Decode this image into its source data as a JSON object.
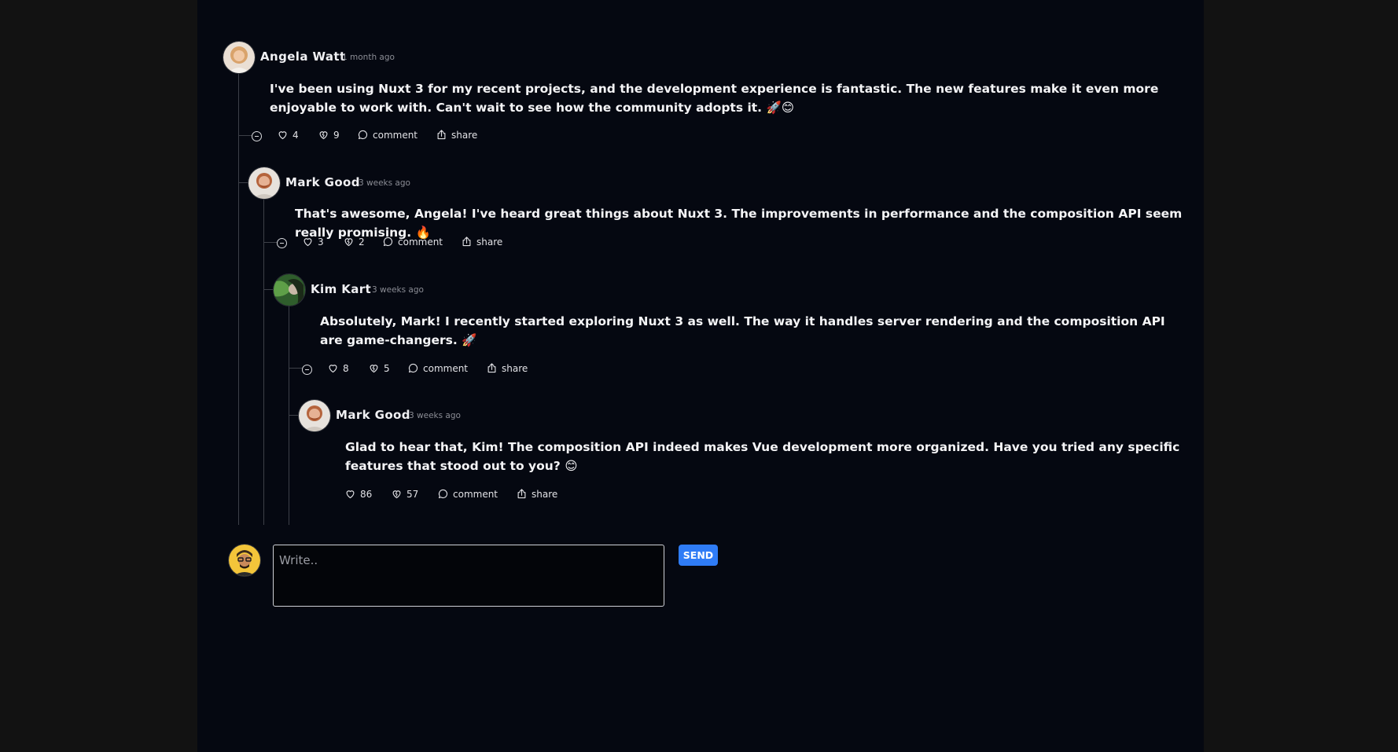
{
  "comments": [
    {
      "author": "Angela Watt",
      "time": "1 month ago",
      "text": "I've been using Nuxt 3 for my recent projects, and the development experience is fantastic. The new features make it even more enjoyable to work with. Can't wait to see how the community adopts it. 🚀😊",
      "likes": "4",
      "dislikes": "9",
      "comment_label": "comment",
      "share_label": "share"
    },
    {
      "author": "Mark Good",
      "time": "3 weeks ago",
      "text": "That's awesome, Angela! I've heard great things about Nuxt 3. The improvements in performance and the composition API seem really promising. 🔥",
      "likes": "3",
      "dislikes": "2",
      "comment_label": "comment",
      "share_label": "share"
    },
    {
      "author": "Kim Kart",
      "time": "3 weeks ago",
      "text": "Absolutely, Mark! I recently started exploring Nuxt 3 as well. The way it handles server rendering and the composition API are game-changers. 🚀",
      "likes": "8",
      "dislikes": "5",
      "comment_label": "comment",
      "share_label": "share"
    },
    {
      "author": "Mark Good",
      "time": "3 weeks ago",
      "text": "Glad to hear that, Kim! The composition API indeed makes Vue development more organized. Have you tried any specific features that stood out to you? 😊",
      "likes": "86",
      "dislikes": "57",
      "comment_label": "comment",
      "share_label": "share"
    }
  ],
  "composer": {
    "placeholder": "Write..",
    "send_label": "SEND"
  },
  "colors": {
    "page_background": "#121212",
    "panel_background": "#050811",
    "accent": "#2f7cf6",
    "thread_line": "#3d4048"
  },
  "icons": {
    "like": "heart-icon",
    "dislike": "heart-crack-icon",
    "comment": "speech-bubble-icon",
    "share": "share-icon",
    "collapse": "collapse-minus-icon"
  }
}
